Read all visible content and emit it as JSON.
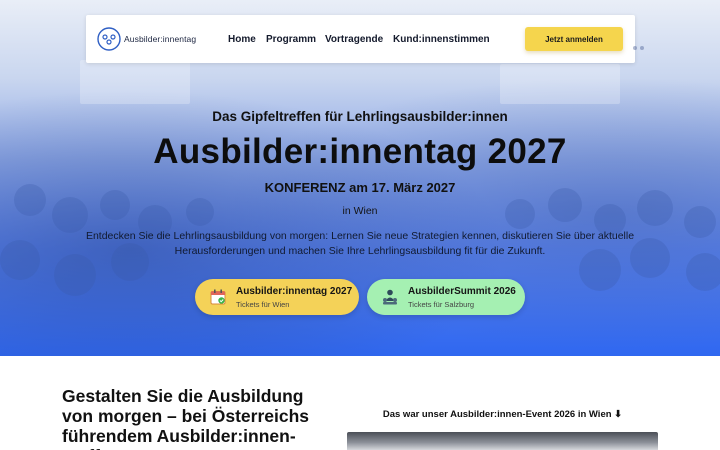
{
  "nav": {
    "logo_text": "Ausbilder:innentag",
    "links": [
      "Home",
      "Programm",
      "Vortragende",
      "Kund:innenstimmen"
    ],
    "cta_label": "Jetzt anmelden"
  },
  "hero": {
    "eyebrow": "Das Gipfeltreffen für Lehrlingsausbilder:innen",
    "title": "Ausbilder:innentag 2027",
    "subtitle": "KONFERENZ am 17. März 2027",
    "location": "in Wien",
    "description": "Entdecken Sie die Lehrlingsausbildung von morgen: Lernen Sie neue Strategien kennen, diskutieren Sie über aktuelle Herausforderungen und machen Sie Ihre Lehrlingsausbildung fit für die Zukunft.",
    "tickets": [
      {
        "title": "Ausbilder:innentag 2027",
        "subtitle": "Tickets für Wien",
        "icon": "calendar-check-icon",
        "color": "#f4d258"
      },
      {
        "title": "AusbilderSummit 2026",
        "subtitle": "Tickets für Salzburg",
        "icon": "audience-icon",
        "color": "#a5f0b2"
      }
    ]
  },
  "section": {
    "heading": "Gestalten Sie die Ausbildung von morgen – bei Österreichs führendem Ausbilder:innen-Treffen",
    "event_caption": "Das war unser Ausbilder:innen-Event 2026 in Wien ⬇"
  },
  "colors": {
    "accent_yellow": "#f5d54d",
    "accent_green": "#a5f0b2",
    "hero_blue": "#2f67f0"
  }
}
